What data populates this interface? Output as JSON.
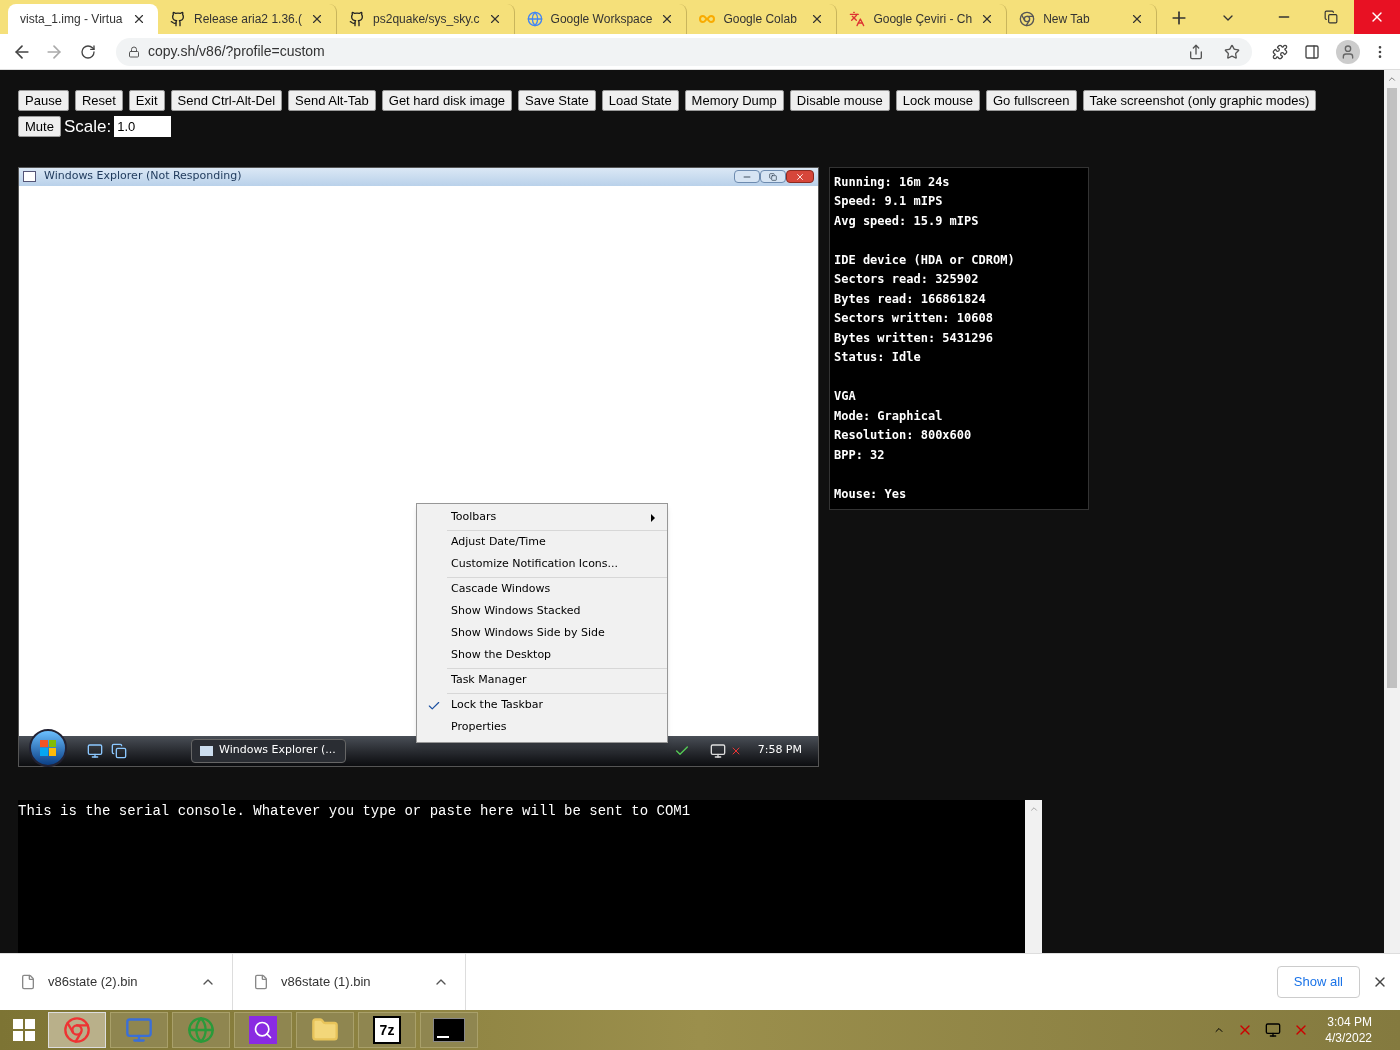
{
  "browser": {
    "tabs": [
      {
        "title": "vista_1.img - Virtua",
        "kind": "emulator",
        "selected": true
      },
      {
        "title": "Release aria2 1.36.(",
        "kind": "github",
        "selected": false
      },
      {
        "title": "ps2quake/sys_sky.c",
        "kind": "github",
        "selected": false
      },
      {
        "title": "Google Workspace",
        "kind": "google",
        "selected": false
      },
      {
        "title": "Google Colab",
        "kind": "colab",
        "selected": false
      },
      {
        "title": "Google Çeviri - Ch",
        "kind": "translate",
        "selected": false
      },
      {
        "title": "New Tab",
        "kind": "chrome",
        "selected": false
      }
    ],
    "address": "copy.sh/v86/?profile=custom"
  },
  "toolbar": {
    "buttons": [
      "Pause",
      "Reset",
      "Exit",
      "Send Ctrl-Alt-Del",
      "Send Alt-Tab",
      "Get hard disk image",
      "Save State",
      "Load State",
      "Memory Dump",
      "Disable mouse",
      "Lock mouse",
      "Go fullscreen",
      "Take screenshot (only graphic modes)",
      "Mute"
    ],
    "scale_label": "Scale:",
    "scale_value": "1.0"
  },
  "vm_screen": {
    "window_title": "Windows Explorer (Not Responding)",
    "taskbar": {
      "task": "Windows Explorer (...",
      "clock": "7:58 PM"
    },
    "context_menu": [
      [
        {
          "label": "Toolbars",
          "submenu": true,
          "checked": false
        }
      ],
      [
        {
          "label": "Adjust Date/Time",
          "submenu": false,
          "checked": false
        },
        {
          "label": "Customize Notification Icons...",
          "submenu": false,
          "checked": false
        }
      ],
      [
        {
          "label": "Cascade Windows",
          "submenu": false,
          "checked": false
        },
        {
          "label": "Show Windows Stacked",
          "submenu": false,
          "checked": false
        },
        {
          "label": "Show Windows Side by Side",
          "submenu": false,
          "checked": false
        },
        {
          "label": "Show the Desktop",
          "submenu": false,
          "checked": false
        }
      ],
      [
        {
          "label": "Task Manager",
          "submenu": false,
          "checked": false
        }
      ],
      [
        {
          "label": "Lock the Taskbar",
          "submenu": false,
          "checked": true
        },
        {
          "label": "Properties",
          "submenu": false,
          "checked": false
        }
      ]
    ]
  },
  "stats": [
    [
      "Running: 16m 24s",
      "Speed: 9.1 mIPS",
      "Avg speed: 15.9 mIPS"
    ],
    [
      "IDE device (HDA or CDROM)",
      "Sectors read: 325902",
      "Bytes read: 166861824",
      "Sectors written: 10608",
      "Bytes written: 5431296",
      "Status: Idle"
    ],
    [
      "VGA",
      "Mode: Graphical",
      "Resolution: 800x600",
      "BPP: 32"
    ],
    [
      "Mouse: Yes"
    ]
  ],
  "serial_console": "This is the serial console. Whatever you type or paste here will be sent to COM1",
  "downloads": {
    "items": [
      "v86state (2).bin",
      "v86state (1).bin"
    ],
    "show_all": "Show all"
  },
  "os_taskbar": {
    "apps": [
      {
        "kind": "chrome",
        "selected": true
      },
      {
        "kind": "computer",
        "selected": false
      },
      {
        "kind": "globe",
        "selected": false
      },
      {
        "kind": "search",
        "selected": false
      },
      {
        "kind": "folder",
        "selected": false
      },
      {
        "kind": "archive",
        "label": "7z",
        "selected": false
      },
      {
        "kind": "terminal",
        "selected": false
      }
    ],
    "time": "3:04 PM",
    "date": "4/3/2022"
  }
}
